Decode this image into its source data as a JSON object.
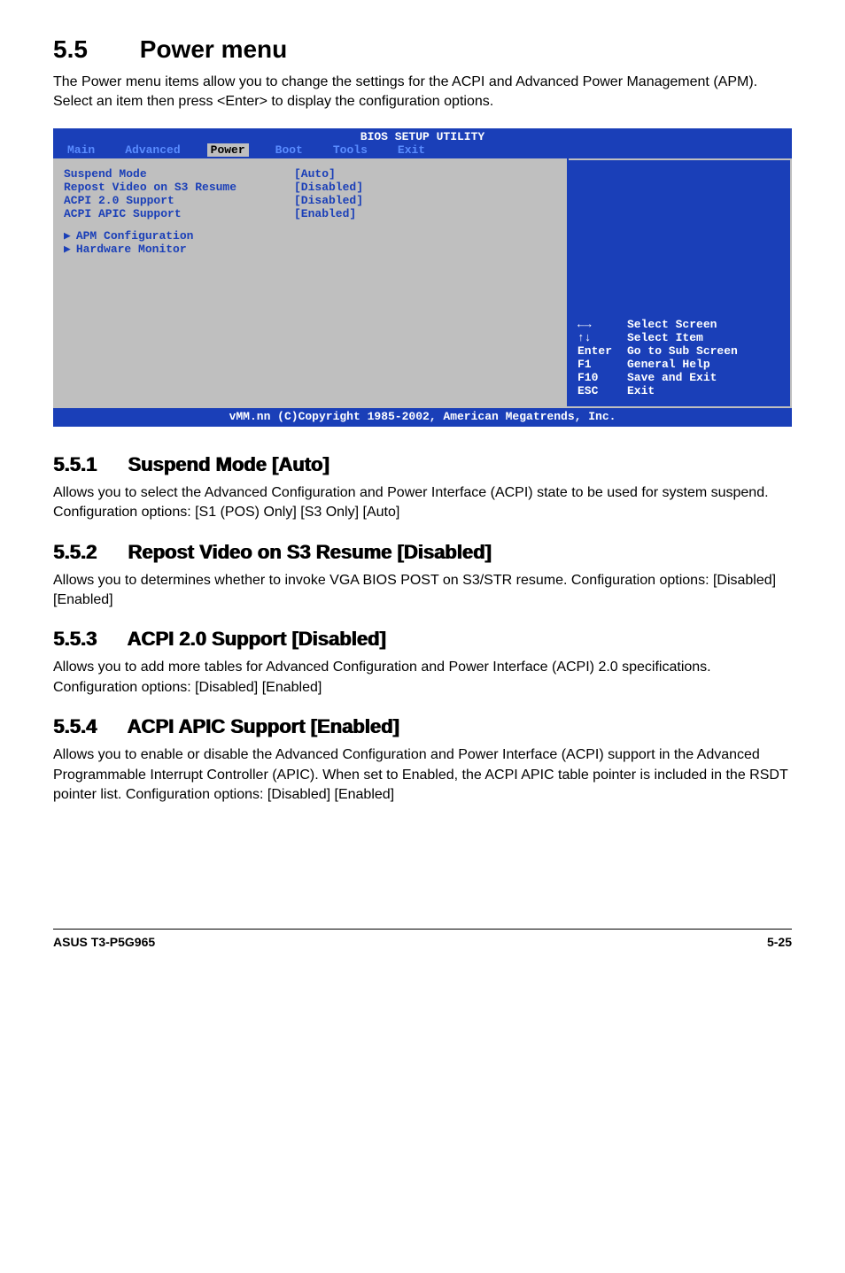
{
  "section": {
    "number": "5.5",
    "title": "Power menu",
    "intro": "The Power menu items allow you to change the settings for the ACPI and Advanced Power Management (APM). Select an item then press <Enter> to display the configuration options."
  },
  "bios": {
    "title": "BIOS SETUP UTILITY",
    "tabs": [
      "Main",
      "Advanced",
      "Power",
      "Boot",
      "Tools",
      "Exit"
    ],
    "active_tab": "Power",
    "items": [
      {
        "label": "Suspend Mode",
        "value": "[Auto]"
      },
      {
        "label": "Repost Video on S3 Resume",
        "value": "[Disabled]"
      },
      {
        "label": "ACPI 2.0 Support",
        "value": "[Disabled]"
      },
      {
        "label": "ACPI APIC Support",
        "value": "[Enabled]"
      }
    ],
    "subs": [
      "APM Configuration",
      "Hardware Monitor"
    ],
    "help": [
      {
        "key": "←→",
        "desc": "Select Screen"
      },
      {
        "key": "↑↓",
        "desc": "Select Item"
      },
      {
        "key": "Enter",
        "desc": "Go to Sub Screen"
      },
      {
        "key": "F1",
        "desc": "General Help"
      },
      {
        "key": "F10",
        "desc": "Save and Exit"
      },
      {
        "key": "ESC",
        "desc": "Exit"
      }
    ],
    "copyright": "vMM.nn (C)Copyright 1985-2002, American Megatrends, Inc."
  },
  "subsections": [
    {
      "number": "5.5.1",
      "title": "Suspend Mode [Auto]",
      "body1": "Allows you to select the Advanced Configuration and Power Interface (ACPI) state to be used for system suspend.",
      "body2": "Configuration options: [S1 (POS) Only] [S3 Only] [Auto]"
    },
    {
      "number": "5.5.2",
      "title": "Repost Video on S3 Resume [Disabled]",
      "body1": "Allows you to determines whether to invoke VGA BIOS POST on S3/STR resume. Configuration options: [Disabled] [Enabled]",
      "body2": ""
    },
    {
      "number": "5.5.3",
      "title": "ACPI 2.0 Support [Disabled]",
      "body1": "Allows you to add more tables for Advanced Configuration and Power Interface (ACPI) 2.0 specifications.",
      "body2": "Configuration options: [Disabled] [Enabled]"
    },
    {
      "number": "5.5.4",
      "title": "ACPI APIC Support [Enabled]",
      "body1": "Allows you to enable or disable the Advanced Configuration and Power Interface (ACPI) support in the Advanced Programmable Interrupt Controller (APIC). When set to Enabled, the ACPI APIC table pointer is included in the RSDT pointer list. Configuration options: [Disabled] [Enabled]",
      "body2": ""
    }
  ],
  "footer": {
    "left": "ASUS T3-P5G965",
    "right": "5-25"
  }
}
